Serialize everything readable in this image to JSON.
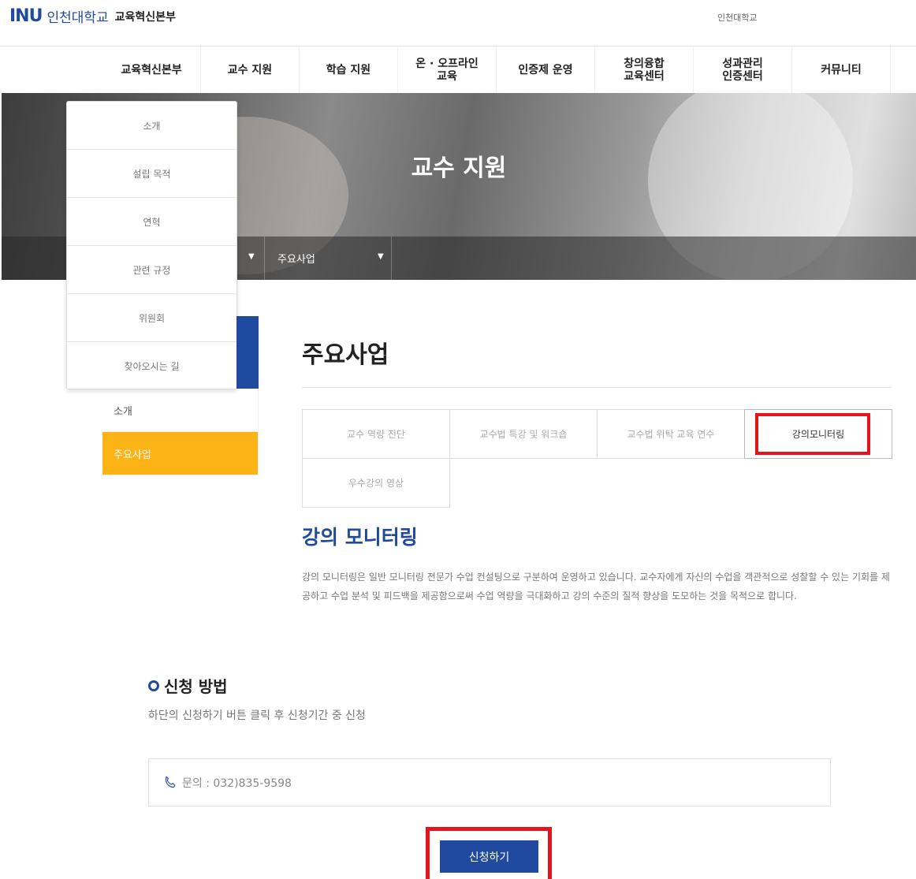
{
  "header": {
    "logo_mark": "INU",
    "univ_name": "인천대학교",
    "dept_name": "교육혁신본부",
    "top_link": "인천대학교"
  },
  "gnb": [
    {
      "label": "교육혁신본부"
    },
    {
      "label": "교수 지원"
    },
    {
      "label": "학습 지원"
    },
    {
      "label": "온 · 오프라인\n교육"
    },
    {
      "label": "인증제 운영"
    },
    {
      "label": "창의융합\n교육센터"
    },
    {
      "label": "성과관리\n인증센터"
    },
    {
      "label": "커뮤니티"
    }
  ],
  "hero": {
    "title": "교수 지원",
    "crumb": "주요사업"
  },
  "dropdown": {
    "items": [
      {
        "label": "소개"
      },
      {
        "label": "설립 목적"
      },
      {
        "label": "연혁"
      },
      {
        "label": "관련 규정"
      },
      {
        "label": "위원회"
      },
      {
        "label": "찾아오시는 길"
      }
    ]
  },
  "sidebar": {
    "items": [
      {
        "label": "소개",
        "active": false
      },
      {
        "label": "주요사업",
        "active": true
      }
    ]
  },
  "main": {
    "page_title": "주요사업",
    "tabs": [
      {
        "label": "교수 역량 진단",
        "active": false
      },
      {
        "label": "교수법 특강 및 워크숍",
        "active": false
      },
      {
        "label": "교수법 위탁 교육 연수",
        "active": false
      },
      {
        "label": "강의모니터링",
        "active": true
      },
      {
        "label": "우수강의 영상",
        "active": false
      }
    ],
    "section_title": "강의 모니터링",
    "description": "강의 모니터링은 일반 모니터링 전문가 수업 컨설팅으로 구분하여 운영하고 있습니다. 교수자에게 자신의 수업을 객관적으로 성찰할 수 있는 기회를 제공하고 수업 분석 및 피드백을 제공함으로써 수업 역량을 극대화하고 강의 수준의 질적 향상을 도모하는 것을 목적으로 합니다.",
    "apply_title": "신청 방법",
    "apply_desc": "하단의 신청하기 버튼 클릭 후 신청기간 중 신청",
    "contact": "문의 : 032)835-9598",
    "apply_button": "신청하기"
  },
  "colors": {
    "brand_blue": "#1f4aa0",
    "accent_yellow": "#fbb316",
    "highlight_red": "#e4141a"
  }
}
